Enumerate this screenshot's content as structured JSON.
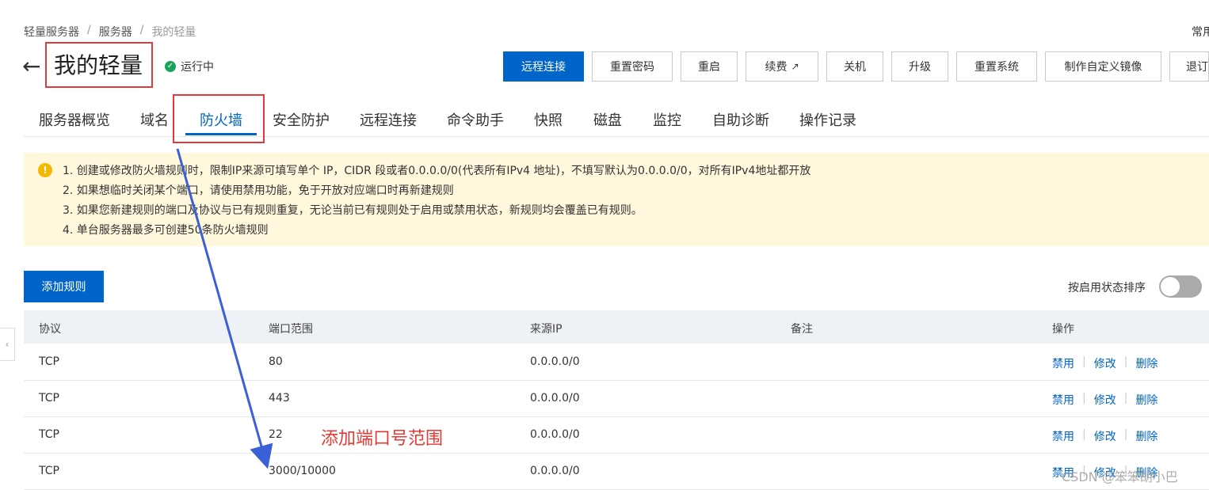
{
  "breadcrumb": {
    "item1": "轻量服务器",
    "item2": "服务器",
    "item3": "我的轻量",
    "sep": "/"
  },
  "top_right_text": "常用",
  "header": {
    "title": "我的轻量",
    "status": "运行中",
    "back_icon": "←"
  },
  "toolbar": {
    "remote": "远程连接",
    "reset_pwd": "重置密码",
    "restart": "重启",
    "renew": "续费",
    "shutdown": "关机",
    "upgrade": "升级",
    "reset_sys": "重置系统",
    "custom_image": "制作自定义镜像",
    "refund": "退订"
  },
  "tabs": [
    "服务器概览",
    "域名",
    "防火墙",
    "安全防护",
    "远程连接",
    "命令助手",
    "快照",
    "磁盘",
    "监控",
    "自助诊断",
    "操作记录"
  ],
  "notice": {
    "line1": "1. 创建或修改防火墙规则时，限制IP来源可填写单个 IP，CIDR 段或者0.0.0.0/0(代表所有IPv4 地址)，不填写默认为0.0.0.0/0，对所有IPv4地址都开放",
    "line2": "2. 如果想临时关闭某个端口，请使用禁用功能，免于开放对应端口时再新建规则",
    "line3": "3. 如果您新建规则的端口及协议与已有规则重复，无论当前已有规则处于启用或禁用状态，新规则均会覆盖已有规则。",
    "line4": "4. 单台服务器最多可创建50条防火墙规则"
  },
  "actions": {
    "add_rule": "添加规则",
    "sort_label": "按启用状态排序"
  },
  "table": {
    "headers": {
      "protocol": "协议",
      "port": "端口范围",
      "source": "来源IP",
      "remark": "备注",
      "ops": "操作"
    },
    "rows": [
      {
        "protocol": "TCP",
        "port": "80",
        "source": "0.0.0.0/0",
        "remark": ""
      },
      {
        "protocol": "TCP",
        "port": "443",
        "source": "0.0.0.0/0",
        "remark": ""
      },
      {
        "protocol": "TCP",
        "port": "22",
        "source": "0.0.0.0/0",
        "remark": ""
      },
      {
        "protocol": "TCP",
        "port": "3000/10000",
        "source": "0.0.0.0/0",
        "remark": ""
      }
    ],
    "op_disable": "禁用",
    "op_edit": "修改",
    "op_delete": "删除"
  },
  "annotation": "添加端口号范围",
  "watermark": "CSDN @笨笨胡小巴",
  "colors": {
    "primary": "#0064c8",
    "annotation_red": "#e53935",
    "notice_bg": "#fff8dc",
    "arrow_blue": "#3b5fd6"
  }
}
